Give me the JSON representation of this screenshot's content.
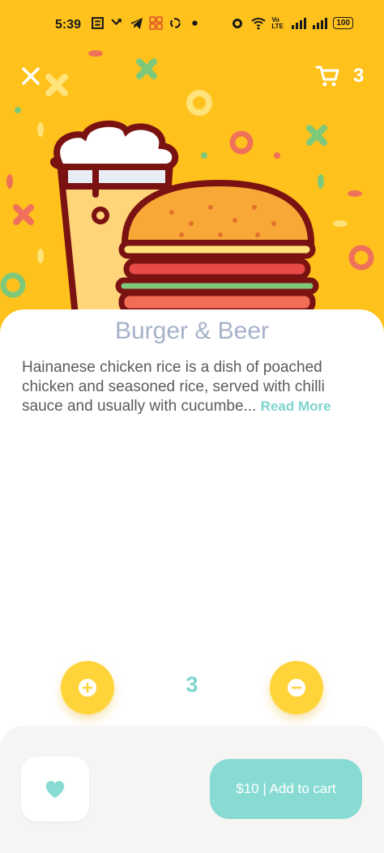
{
  "status_bar": {
    "time": "5:39",
    "battery": "100",
    "network_label": "Vo LTE"
  },
  "header": {
    "close_icon": "close-icon",
    "cart_icon": "cart-icon",
    "cart_count": "3"
  },
  "product": {
    "title": "Burger & Beer",
    "description": "Hainanese chicken rice is a dish of poached chicken and seasoned rice, served with chilli sauce and usually with cucumbe...",
    "read_more": "Read More"
  },
  "quantity": {
    "value": "3",
    "plus_icon": "plus-icon",
    "minus_icon": "minus-icon"
  },
  "actions": {
    "favorite_icon": "heart-icon",
    "add_to_cart": "$10 | Add to cart"
  },
  "colors": {
    "hero_bg": "#FFC21C",
    "accent": "#87DBD3",
    "qty_button": "#FFD43B",
    "title": "#A6B2C9"
  }
}
